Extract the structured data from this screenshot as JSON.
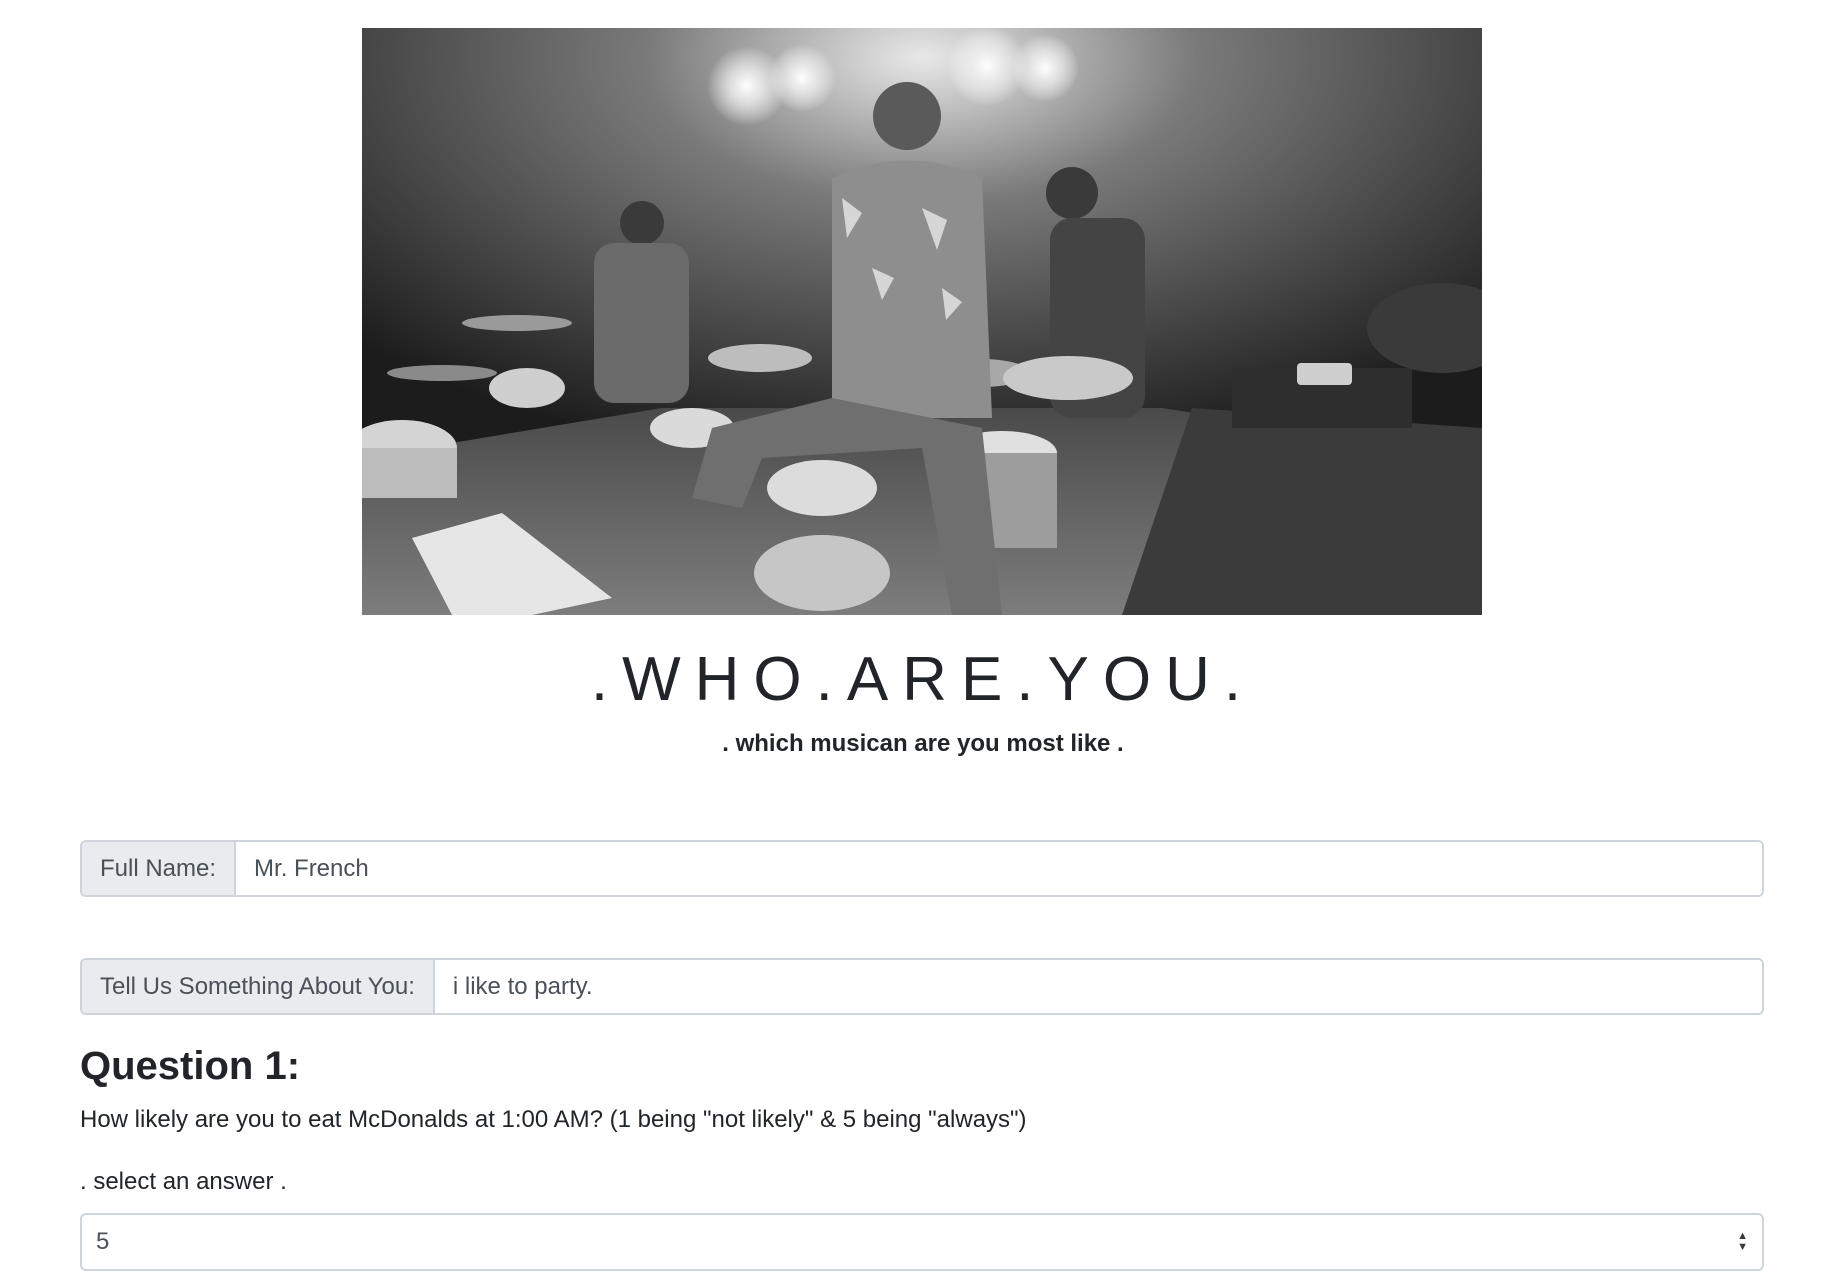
{
  "header": {
    "title": ".WHO.ARE.YOU.",
    "subtitle": ". which musican are you most like ."
  },
  "form": {
    "full_name": {
      "label": "Full Name:",
      "value": "Mr. French"
    },
    "about": {
      "label": "Tell Us Something About You:",
      "value": "i like to party."
    }
  },
  "question_1": {
    "heading": "Question 1:",
    "text": "How likely are you to eat McDonalds at 1:00 AM? (1 being \"not likely\" & 5 being \"always\")",
    "prompt": ". select an answer .",
    "selected": "5"
  },
  "icons": {
    "select_arrows": "chevron-up-down-icon"
  }
}
